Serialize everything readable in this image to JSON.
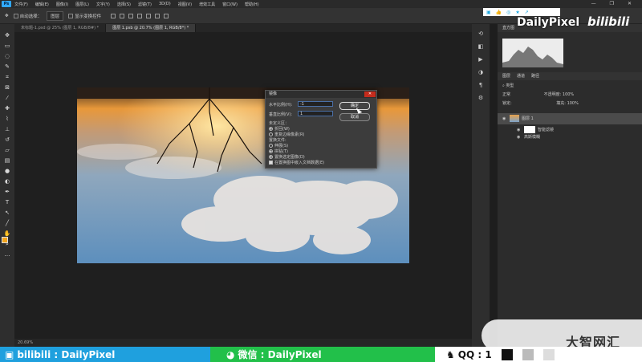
{
  "menubar": {
    "app_icon": "Ps",
    "items": [
      "文件(F)",
      "编辑(E)",
      "图像(I)",
      "图层(L)",
      "文字(Y)",
      "选择(S)",
      "滤镜(T)",
      "3D(D)",
      "视图(V)",
      "增效工具",
      "窗口(W)",
      "帮助(H)"
    ],
    "controls": [
      "—",
      "❐",
      "✕"
    ]
  },
  "options": {
    "auto_select_label": "自动选择：",
    "target_value": "图层",
    "transform_label": "显示变换控件"
  },
  "tabs": [
    {
      "label": "未标题-1.psd @ 25% (图层 1, RGB/8#) *",
      "active": false
    },
    {
      "label": "图层 1.psb @ 20.7% (图层 1, RGB/8*) *",
      "active": true
    }
  ],
  "status": {
    "zoom": "20.69%"
  },
  "dialog": {
    "title": "镜像",
    "close": "✕",
    "horizontal_label": "水平比例(H):",
    "horizontal_value": "-1",
    "vertical_label": "垂直比例(V):",
    "vertical_value": "1",
    "ok": "确定",
    "cancel": "取消",
    "undefined_group": "未定义区：",
    "opt_wrap": "折回(W)",
    "opt_repeat": "重复边缘像素(R)",
    "displacement_group": "置换文件:",
    "opt_stretch": "伸展(S)",
    "opt_tile": "拼贴(T)",
    "opt_replace": "置换选定图像(D)",
    "opt_embed": "在置换图中嵌入文档数据(E)"
  },
  "panels": {
    "histogram_tab": "直方图",
    "layers_tabs": [
      "图层",
      "通道",
      "路径"
    ],
    "filter_kind": "类型",
    "blend_mode": "正常",
    "opacity_label": "不透明度:",
    "opacity_value": "100%",
    "lock_label": "锁定:",
    "fill_label": "填充:",
    "fill_value": "100%",
    "layers": [
      {
        "name": "图层 1",
        "selected": true
      },
      {
        "name": "智能滤镜",
        "selected": false
      },
      {
        "name": "高斯模糊",
        "selected": false
      }
    ]
  },
  "watermark": {
    "channel": "DailyPixel",
    "site": "bilibili",
    "brand": "大智网汇"
  },
  "bottom_bar": {
    "bili_label": "bilibili : DailyPixel",
    "wechat_label": "微信 : DailyPixel",
    "qq_label": "QQ : 1"
  },
  "colors": {
    "accent": "#31a8ff",
    "foreground": "#f2a41c",
    "bili_blue": "#1fa0de",
    "wechat_green": "#22c04a"
  }
}
